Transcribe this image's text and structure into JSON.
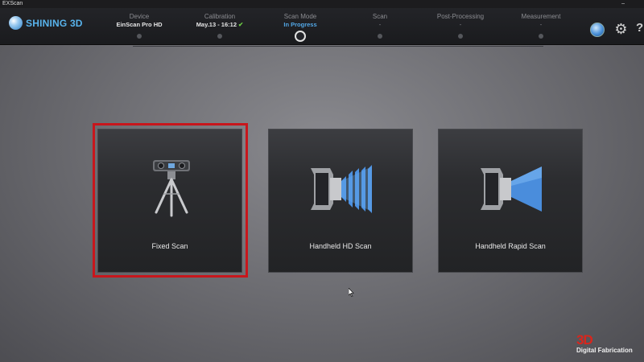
{
  "window": {
    "title": "EXScan",
    "minimize_glyph": "–"
  },
  "brand": {
    "name": "SHINING 3D"
  },
  "steps": [
    {
      "label": "Device",
      "value": "EinScan Pro HD",
      "state": "done"
    },
    {
      "label": "Calibration",
      "value": "May.13 - 16:12",
      "check": "✔",
      "state": "done"
    },
    {
      "label": "Scan Mode",
      "value": "In Progress",
      "state": "current"
    },
    {
      "label": "Scan",
      "value": "-",
      "state": "pending"
    },
    {
      "label": "Post-Processing",
      "value": "-",
      "state": "pending"
    },
    {
      "label": "Measurement",
      "value": "-",
      "state": "pending"
    }
  ],
  "toolbar": {
    "language_icon": "globe-icon",
    "settings_icon": "gear-icon",
    "settings_glyph": "⚙",
    "help_icon": "question-icon",
    "help_glyph": "?"
  },
  "scan_modes": [
    {
      "label": "Fixed Scan",
      "icon": "tripod-scanner-icon",
      "selected": true
    },
    {
      "label": "Handheld HD Scan",
      "icon": "handheld-hd-scanner-icon",
      "selected": false
    },
    {
      "label": "Handheld Rapid Scan",
      "icon": "handheld-rapid-scanner-icon",
      "selected": false
    }
  ],
  "watermark": {
    "logo": "3D",
    "subtitle": "Digital Fabrication"
  },
  "colors": {
    "brand_blue": "#58b3ec",
    "active_step": "#52a7e6",
    "check_green": "#6fcf45",
    "selection_red": "#c8161c",
    "watermark_red": "#d8261d"
  }
}
